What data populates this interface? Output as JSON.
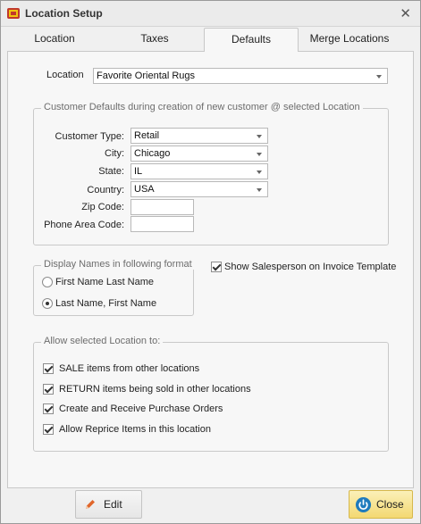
{
  "window": {
    "title": "Location Setup",
    "close_glyph": "✕"
  },
  "tabs": [
    {
      "label": "Location"
    },
    {
      "label": "Taxes"
    },
    {
      "label": "Defaults",
      "active": true
    },
    {
      "label": "Merge Locations"
    }
  ],
  "location": {
    "label": "Location",
    "value": "Favorite Oriental Rugs"
  },
  "customer_defaults": {
    "title": "Customer Defaults during creation of new customer @ selected Location",
    "customer_type": {
      "label": "Customer Type:",
      "value": "Retail"
    },
    "city": {
      "label": "City:",
      "value": "Chicago"
    },
    "state": {
      "label": "State:",
      "value": "IL"
    },
    "country": {
      "label": "Country:",
      "value": "USA"
    },
    "zip": {
      "label": "Zip Code:",
      "value": ""
    },
    "phone": {
      "label": "Phone Area Code:",
      "value": ""
    }
  },
  "display_names": {
    "title": "Display Names in following format",
    "options": [
      {
        "label": "First Name  Last Name",
        "selected": false
      },
      {
        "label": "Last Name, First Name",
        "selected": true
      }
    ]
  },
  "show_salesperson": {
    "label": "Show Salesperson on Invoice Template",
    "checked": true
  },
  "allow": {
    "title": "Allow selected Location to:",
    "items": [
      {
        "label": "SALE items from other locations",
        "checked": true
      },
      {
        "label": "RETURN items being sold in other locations",
        "checked": true
      },
      {
        "label": "Create and Receive Purchase Orders",
        "checked": true
      },
      {
        "label": "Allow Reprice Items in this location",
        "checked": true
      }
    ]
  },
  "buttons": {
    "edit": "Edit",
    "close": "Close"
  },
  "colors": {
    "close_button": "#f3d872",
    "panel": "#f7f7f7",
    "window": "#f0f0f0"
  },
  "icons": {
    "app": "app-icon",
    "edit": "pencil-icon",
    "close": "power-icon"
  }
}
